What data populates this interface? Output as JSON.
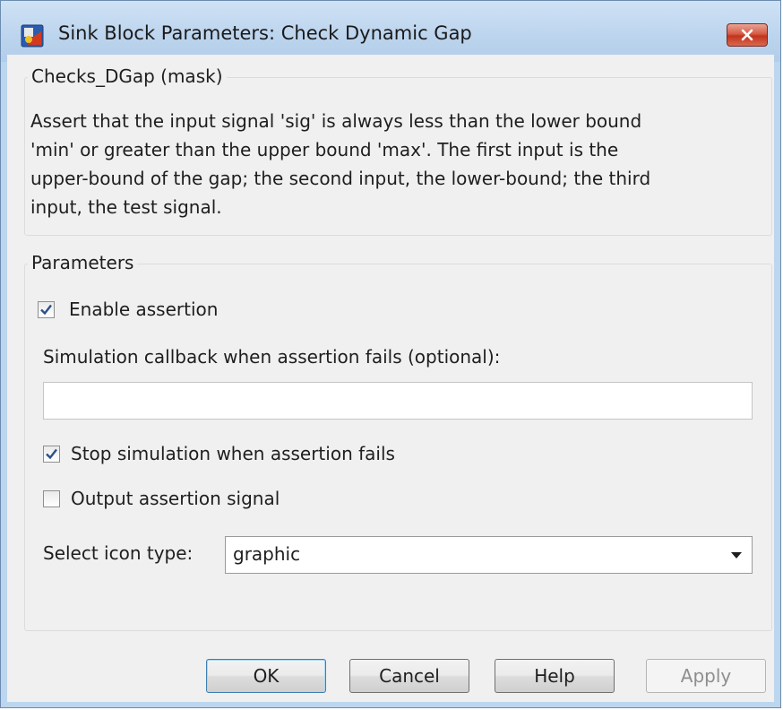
{
  "window": {
    "title": "Sink Block Parameters: Check Dynamic Gap"
  },
  "mask_group": {
    "title": "Checks_DGap (mask)",
    "description_lines": [
      "Assert that the input signal 'sig' is always less than the lower bound",
      "'min' or greater than the upper bound 'max'.  The first input is the",
      "upper-bound of the gap; the second input, the lower-bound; the third",
      "input, the test signal."
    ]
  },
  "parameters": {
    "title": "Parameters",
    "enable_assertion": {
      "label": "Enable assertion",
      "checked": true
    },
    "callback": {
      "label": "Simulation callback when assertion fails (optional):",
      "value": ""
    },
    "stop_simulation": {
      "label": "Stop simulation when assertion fails",
      "checked": true
    },
    "output_signal": {
      "label": "Output assertion signal",
      "checked": false
    },
    "icon_type": {
      "label": "Select icon type:",
      "value": "graphic"
    }
  },
  "buttons": {
    "ok": "OK",
    "cancel": "Cancel",
    "help": "Help",
    "apply": "Apply"
  },
  "icons": {
    "app": "simulink-block-icon",
    "close": "close-icon",
    "check": "checkmark-icon",
    "dropdown": "chevron-down-icon"
  },
  "colors": {
    "title_bar": "#bdd5ee",
    "close_button": "#c2331c",
    "client_bg": "#f0f0f0",
    "checkmark": "#2d4f8a"
  }
}
